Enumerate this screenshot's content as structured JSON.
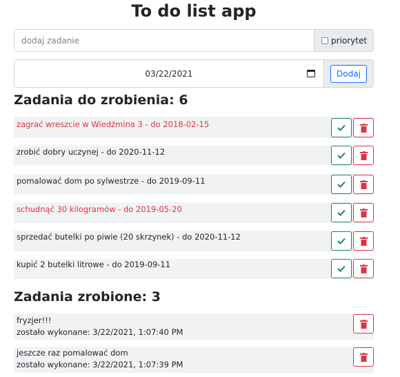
{
  "app": {
    "title": "To do list app"
  },
  "add_form": {
    "placeholder": "dodaj zadanie",
    "priority_label": "priorytet",
    "date_value": "03/22/2021",
    "add_label": "Dodaj"
  },
  "todo": {
    "heading": "Zadania do zrobienia: 6",
    "items": [
      {
        "text": "zagrać wreszcie w Wiedźmina 3 - do 2018-02-15",
        "priority": true
      },
      {
        "text": "zrobić dobry uczynej - do 2020-11-12",
        "priority": false
      },
      {
        "text": "pomalować dom po sylwestrze - do 2019-09-11",
        "priority": false
      },
      {
        "text": "schudnąć 30 kilogramów - do 2019-05-20",
        "priority": true
      },
      {
        "text": "sprzedać butelki po piwie (20 skrzynek) - do 2020-11-12",
        "priority": false
      },
      {
        "text": "kupić 2 butelki litrowe - do 2019-09-11",
        "priority": false
      }
    ]
  },
  "done": {
    "heading": "Zadania zrobione: 3",
    "items": [
      {
        "text": "fryzjer!!!",
        "completed": "zostało wykonane: 3/22/2021, 1:07:40 PM"
      },
      {
        "text": "jeszcze raz pomalować dom",
        "completed": "zostało wykonane: 3/22/2021, 1:07:39 PM"
      }
    ]
  }
}
